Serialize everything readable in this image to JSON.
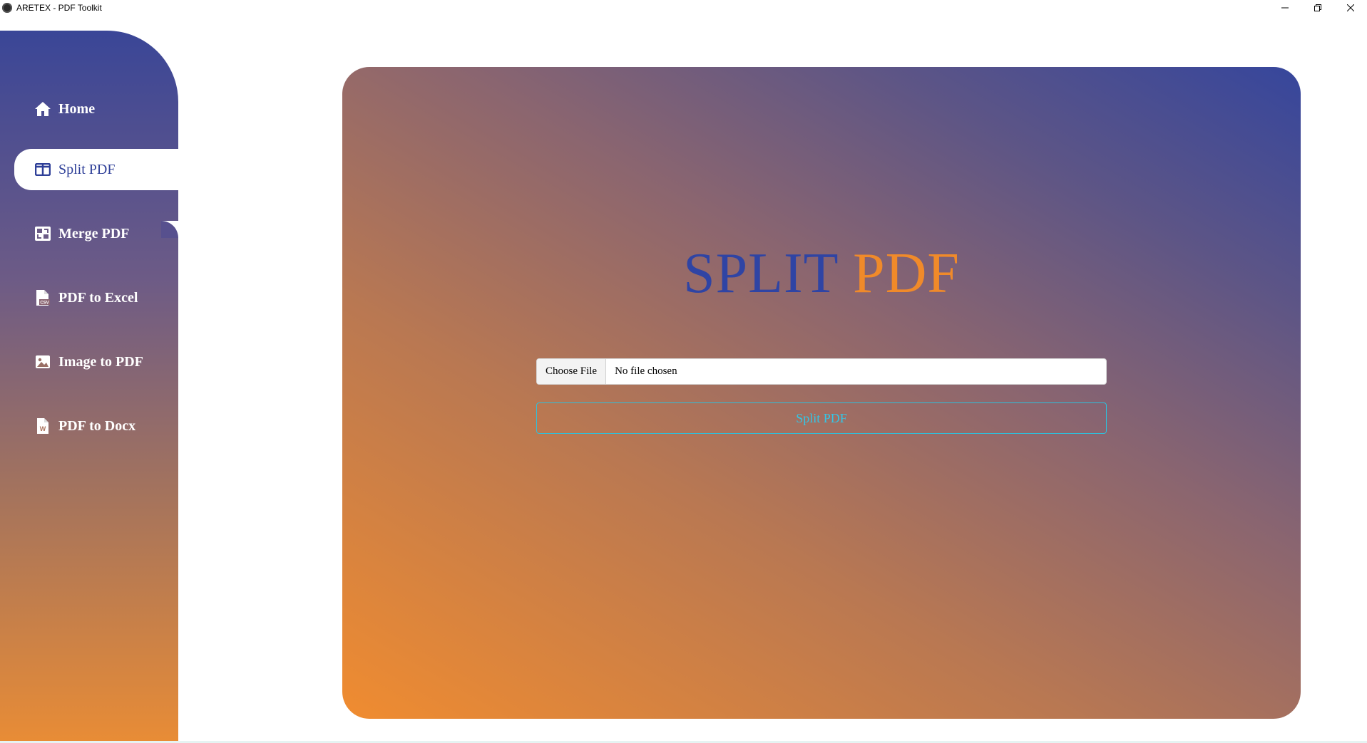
{
  "window": {
    "title": "ARETEX - PDF Toolkit",
    "controls": [
      "minimize-icon",
      "restore-icon",
      "close-icon"
    ]
  },
  "sidebar": {
    "items": [
      {
        "label": "Home",
        "icon": "home-icon",
        "active": false
      },
      {
        "label": "Split PDF",
        "icon": "columns-icon",
        "active": true
      },
      {
        "label": "Merge PDF",
        "icon": "merge-icon",
        "active": false
      },
      {
        "label": "PDF to Excel",
        "icon": "file-csv-icon",
        "active": false
      },
      {
        "label": "Image to PDF",
        "icon": "image-icon",
        "active": false
      },
      {
        "label": "PDF to Docx",
        "icon": "file-word-icon",
        "active": false
      }
    ]
  },
  "main": {
    "heading_first": "SPLIT",
    "heading_second": "PDF",
    "file_input": {
      "button_label": "Choose File",
      "status": "No file chosen"
    },
    "submit_label": "Split PDF"
  },
  "colors": {
    "accent_blue": "#2f44a4",
    "accent_orange": "#f08a2a",
    "button_cyan": "#33c6e6"
  }
}
